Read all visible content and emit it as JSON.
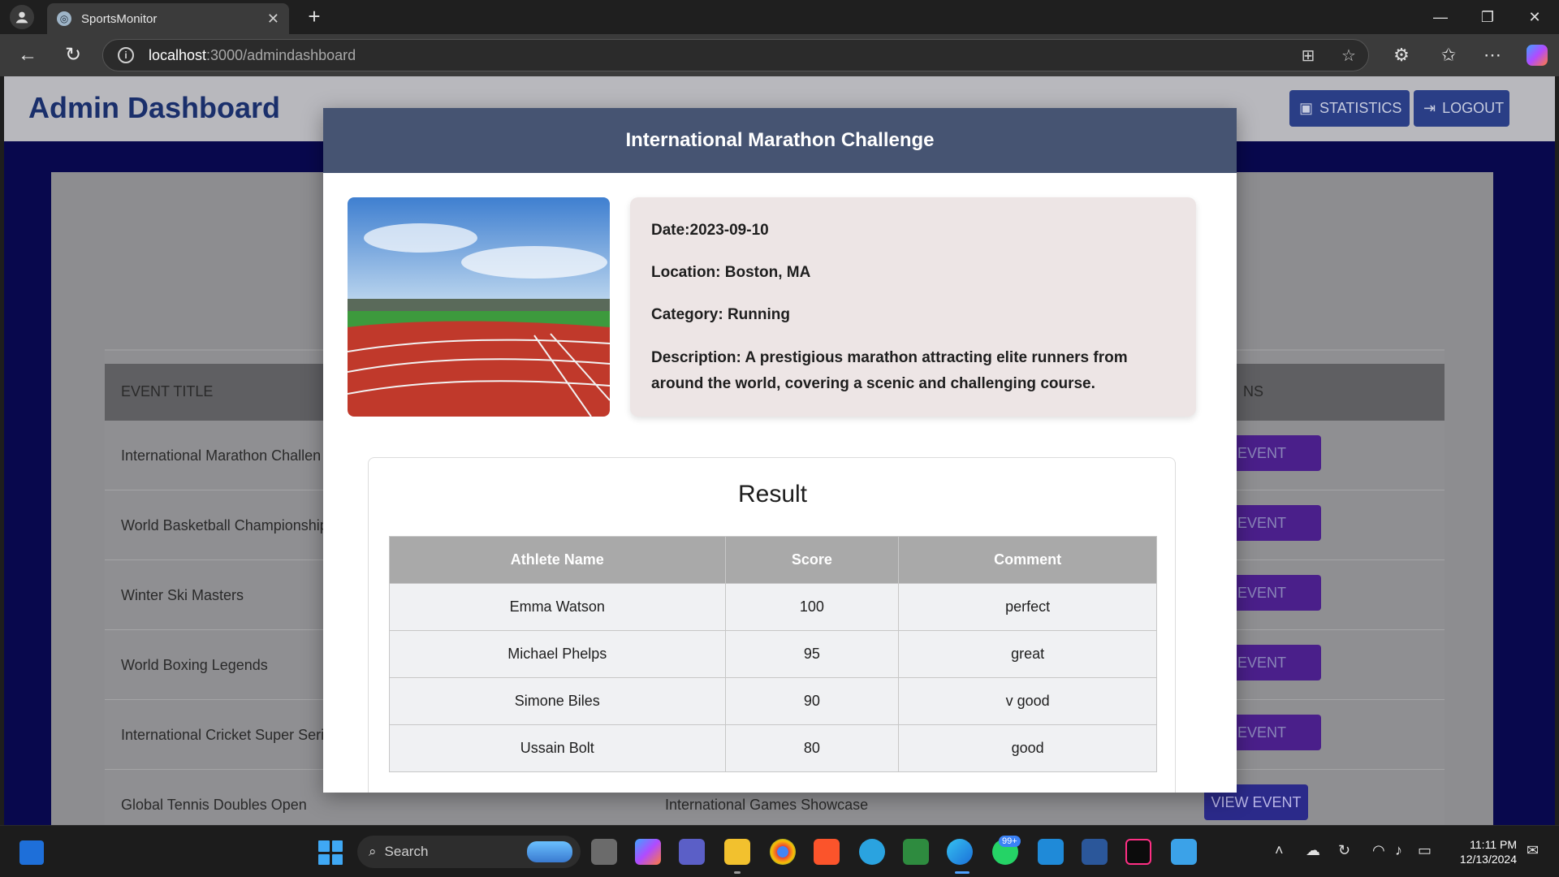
{
  "browser": {
    "tab_title": "SportsMonitor",
    "tab_close": "✕",
    "new_tab": "+",
    "url_host": "localhost",
    "url_path": ":3000/admindashboard"
  },
  "header": {
    "title": "Admin Dashboard",
    "statistics_label": "STATISTICS",
    "logout_label": "LOGOUT"
  },
  "events_table": {
    "columns": [
      "EVENT TITLE",
      "NS"
    ],
    "rows": [
      {
        "title": "International Marathon Challenge",
        "partial_title": "International Marathon Challen",
        "action": "EVENT"
      },
      {
        "title": "World Basketball Championship",
        "partial_title": "World Basketball Championship",
        "action": "EVENT"
      },
      {
        "title": "Winter Ski Masters",
        "partial_title": "Winter Ski Masters",
        "action": "EVENT"
      },
      {
        "title": "World Boxing Legends",
        "partial_title": "World Boxing Legends",
        "action": "EVENT"
      },
      {
        "title": "International Cricket Super Series",
        "partial_title": "International Cricket Super Seri",
        "action": "EVENT"
      },
      {
        "title": "Global Tennis Doubles Open",
        "partial_title": "Global Tennis Doubles Open",
        "col2": "International Games Showcase",
        "action": "VIEW EVENT"
      }
    ]
  },
  "modal": {
    "title": "International Marathon Challenge",
    "date": "Date:2023-09-10",
    "location": "Location: Boston, MA",
    "category": "Category: Running",
    "description": "Description: A prestigious marathon attracting elite runners from around the world, covering a scenic and challenging course.",
    "result": {
      "title": "Result",
      "headers": [
        "Athlete Name",
        "Score",
        "Comment"
      ],
      "rows": [
        [
          "Emma Watson",
          "100",
          "perfect"
        ],
        [
          "Michael Phelps",
          "95",
          "great"
        ],
        [
          "Simone Biles",
          "90",
          "v good"
        ],
        [
          "Ussain Bolt",
          "80",
          "good"
        ]
      ]
    }
  },
  "taskbar": {
    "search_label": "Search",
    "badge": "99+",
    "time": "11:11 PM",
    "date": "12/13/2024"
  },
  "colors": {
    "modal_header": "#465472",
    "title_blue": "#1a2f6b",
    "table_header": "#a9a9a9"
  }
}
